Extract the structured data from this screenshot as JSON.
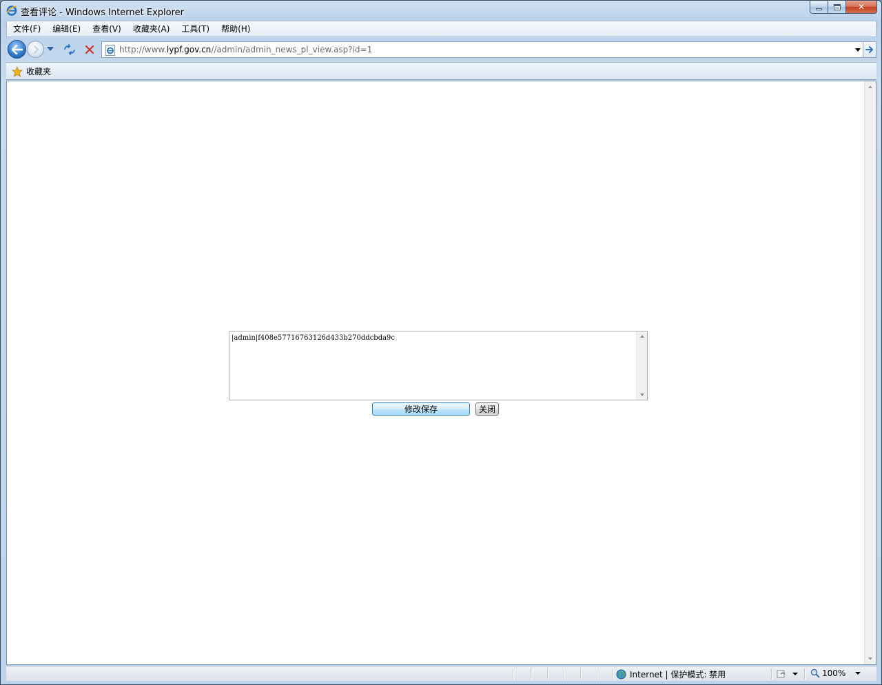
{
  "window": {
    "title": "查看评论 - Windows Internet Explorer",
    "controls": {
      "minimize": "",
      "maximize": "",
      "close": "✕"
    }
  },
  "menubar": {
    "items": [
      "文件(F)",
      "编辑(E)",
      "查看(V)",
      "收藏夹(A)",
      "工具(T)",
      "帮助(H)"
    ]
  },
  "address": {
    "url_prefix": "http://www.",
    "url_domain": "lypf.gov.cn",
    "url_path": "//admin/admin_news_pl_view.asp?id=1"
  },
  "favorites": {
    "label": "收藏夹"
  },
  "page": {
    "comment_text": "|admin|f408e57716763126d433b270ddcbda9c",
    "save_button": "修改保存",
    "close_button": "关闭"
  },
  "statusbar": {
    "zone": "Internet | 保护模式: 禁用",
    "zoom": "100%"
  },
  "icons": {
    "app": "ie-logo-icon",
    "back": "back-arrow-icon",
    "forward": "forward-arrow-icon",
    "refresh": "refresh-icon",
    "stop": "stop-icon",
    "page": "page-icon",
    "go": "go-arrow-icon",
    "favorites": "favorites-star-icon",
    "zone": "globe-icon",
    "zoom": "magnifier-icon"
  },
  "colors": {
    "ie_blue": "#1f6fc8",
    "stop_red": "#c8332a",
    "star_gold": "#f2b61c"
  }
}
